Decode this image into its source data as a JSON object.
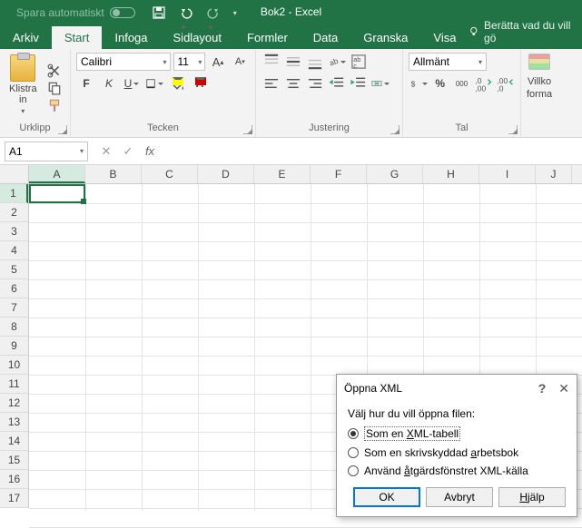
{
  "titlebar": {
    "autosave": "Spara automatiskt",
    "doc_title": "Bok2 - Excel"
  },
  "tabs": {
    "file": "Arkiv",
    "home": "Start",
    "insert": "Infoga",
    "pagelayout": "Sidlayout",
    "formulas": "Formler",
    "data": "Data",
    "review": "Granska",
    "view": "Visa",
    "tellme": "Berätta vad du vill gö"
  },
  "ribbon": {
    "clipboard": {
      "paste": "Klistra\nin",
      "label": "Urklipp"
    },
    "font": {
      "name": "Calibri",
      "size": "11",
      "label": "Tecken"
    },
    "align": {
      "label": "Justering"
    },
    "number": {
      "format": "Allmänt",
      "label": "Tal"
    },
    "styles": {
      "cond": "Villko",
      "fmt": "forma"
    }
  },
  "fbar": {
    "cell": "A1"
  },
  "cols": [
    "A",
    "B",
    "C",
    "D",
    "E",
    "F",
    "G",
    "H",
    "I",
    "J"
  ],
  "rows": [
    "1",
    "2",
    "3",
    "4",
    "5",
    "6",
    "7",
    "8",
    "9",
    "10",
    "11",
    "12",
    "13",
    "14",
    "15",
    "16",
    "17"
  ],
  "dialog": {
    "title": "Öppna XML",
    "prompt": "Välj hur du vill öppna filen:",
    "opt1_pre": "Som en ",
    "opt1_u": "X",
    "opt1_post": "ML-tabell",
    "opt2_pre": "Som en skrivskyddad ",
    "opt2_u": "a",
    "opt2_post": "rbetsbok",
    "opt3_pre": "Använd ",
    "opt3_u": "å",
    "opt3_post": "tgärdsfönstret XML-källa",
    "ok": "OK",
    "cancel": "Avbryt",
    "help_u": "H",
    "help_post": "jälp"
  }
}
